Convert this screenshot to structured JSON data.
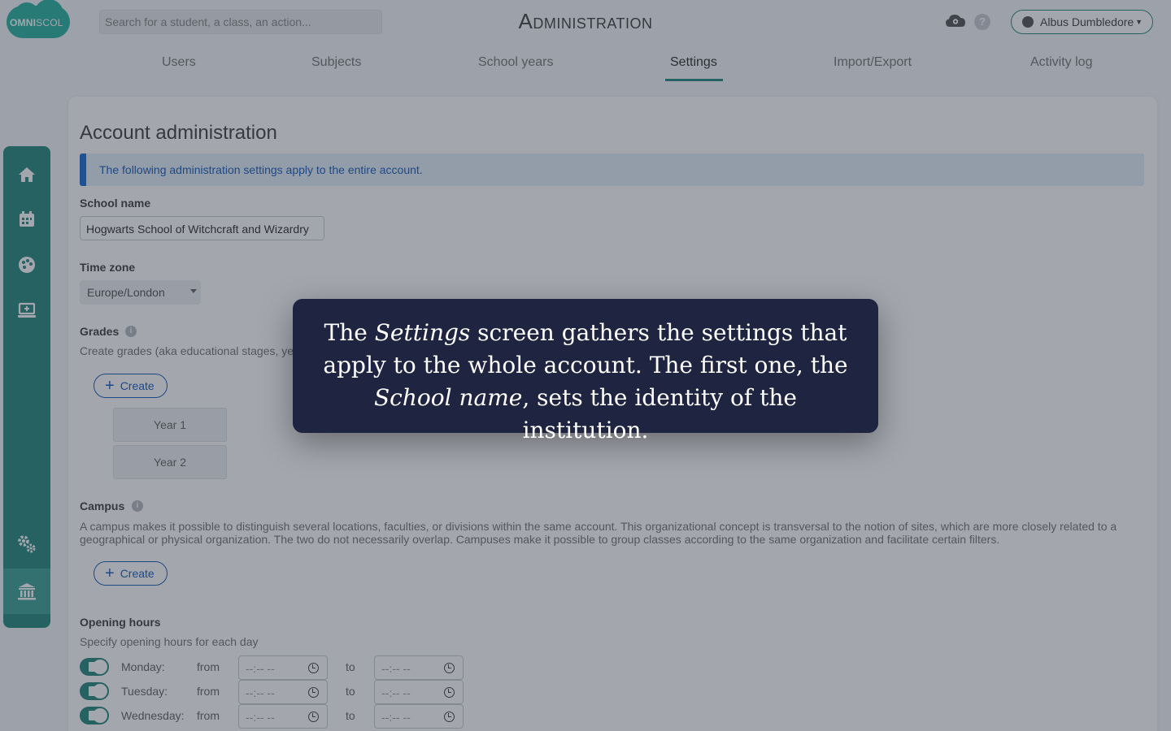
{
  "header": {
    "logo": {
      "bold": "OMNI",
      "light": "SCOL"
    },
    "search_placeholder": "Search for a student, a class, an action...",
    "title": "Administration",
    "user": "Albus Dumbledore"
  },
  "tabs": [
    {
      "label": "Users"
    },
    {
      "label": "Subjects"
    },
    {
      "label": "School years"
    },
    {
      "label": "Settings",
      "active": true
    },
    {
      "label": "Import/Export"
    },
    {
      "label": "Activity log"
    }
  ],
  "sidebar": {
    "items": [
      {
        "icon": "home-icon"
      },
      {
        "icon": "calendar-icon"
      },
      {
        "icon": "palette-icon"
      },
      {
        "icon": "monitor-add-icon"
      },
      {
        "icon": "gears-icon"
      },
      {
        "icon": "institution-icon",
        "active": true
      }
    ]
  },
  "main": {
    "title": "Account administration",
    "info": "The following administration settings apply to the entire account.",
    "school_name": {
      "label": "School name",
      "value": "Hogwarts School of Witchcraft and Wizardry"
    },
    "time_zone": {
      "label": "Time zone",
      "value": "Europe/London"
    },
    "grades": {
      "label": "Grades",
      "description": "Create grades (aka educational stages, ye",
      "create_label": "Create",
      "items": [
        "Year 1",
        "Year 2"
      ]
    },
    "campus": {
      "label": "Campus",
      "description": "A campus makes it possible to distinguish several locations, faculties, or divisions within the same account. This organizational concept is transversal to the notion of sites, which are more closely related to a geographical or physical organization. The two do not necessarily overlap. Campuses make it possible to group classes according to the same organization and facilitate certain filters.",
      "create_label": "Create"
    },
    "opening_hours": {
      "label": "Opening hours",
      "description": "Specify opening hours for each day",
      "from_label": "from",
      "to_label": "to",
      "time_placeholder": "--:-- --",
      "days": [
        {
          "day": "Monday:",
          "enabled": true
        },
        {
          "day": "Tuesday:",
          "enabled": true
        },
        {
          "day": "Wednesday:",
          "enabled": true
        }
      ]
    }
  },
  "tooltip": {
    "t1": "The ",
    "t2": "Settings",
    "t3": " screen gathers the settings that apply to the whole account. The first one, the ",
    "t4": "School name",
    "t5": ", sets the identity of the institution."
  }
}
